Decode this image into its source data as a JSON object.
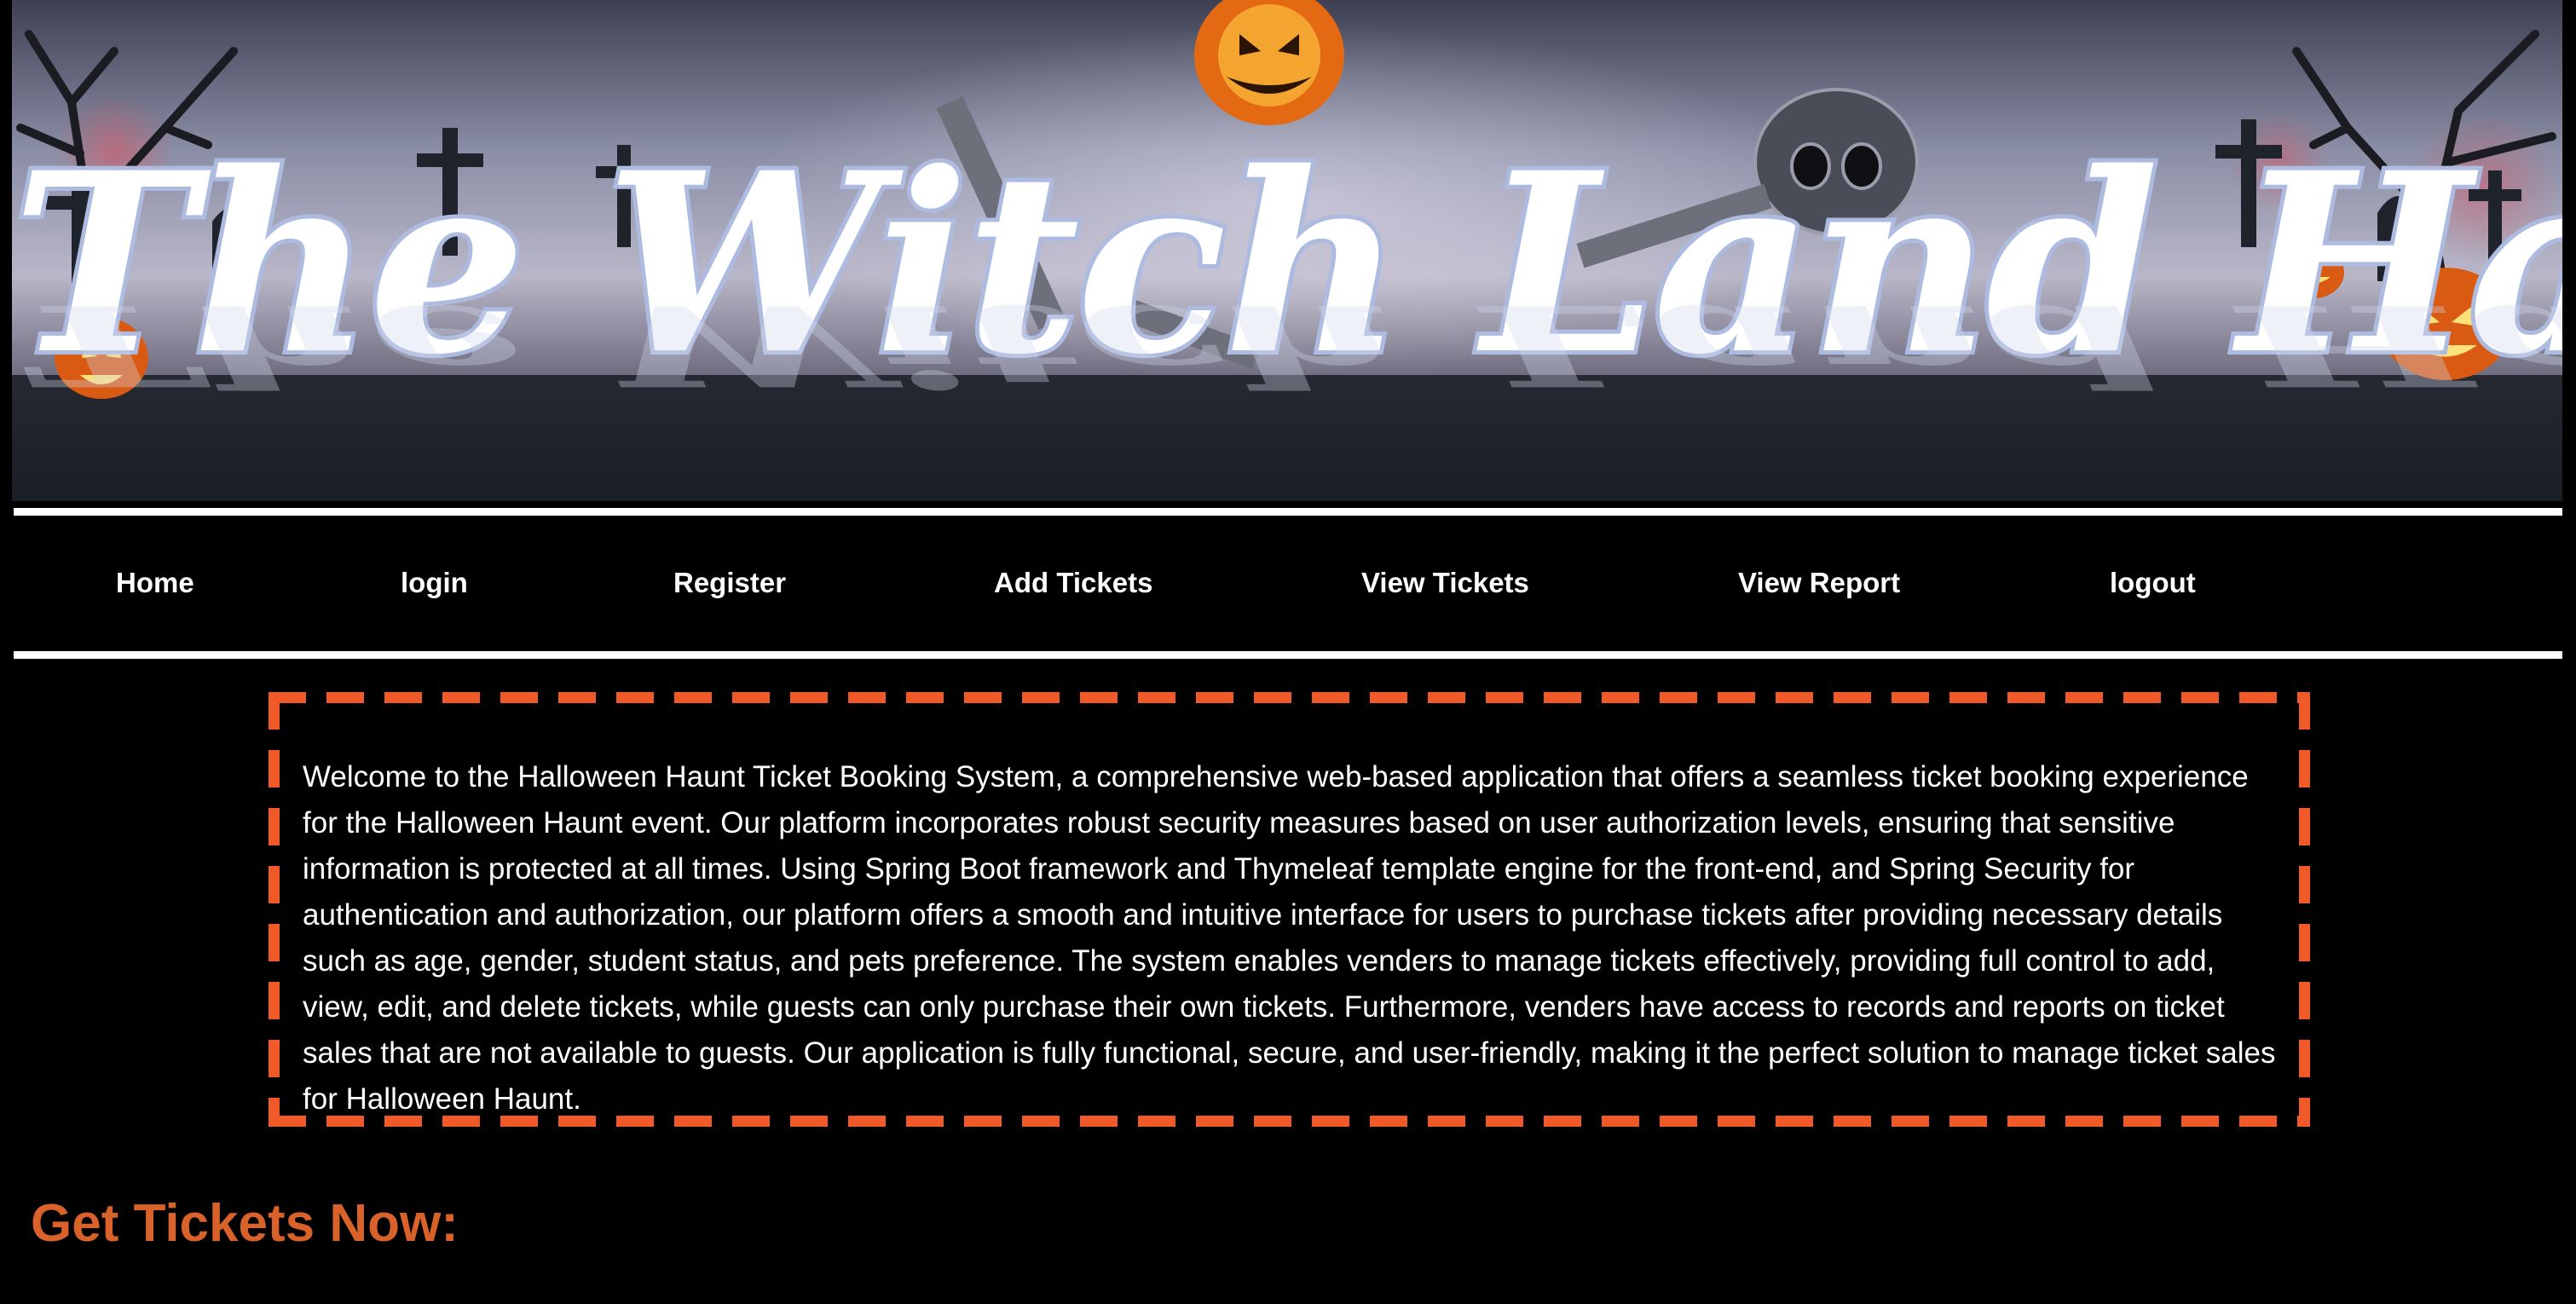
{
  "banner": {
    "title": "The Witch Land Haunt"
  },
  "nav": {
    "items": [
      {
        "label": "Home"
      },
      {
        "label": "login"
      },
      {
        "label": "Register"
      },
      {
        "label": "Add Tickets"
      },
      {
        "label": "View Tickets"
      },
      {
        "label": "View Report"
      },
      {
        "label": "logout"
      }
    ]
  },
  "intro": {
    "text": "Welcome to the Halloween Haunt Ticket Booking System, a comprehensive web-based application that offers a seamless ticket booking experience for the Halloween Haunt event. Our platform incorporates robust security measures based on user authorization levels, ensuring that sensitive information is protected at all times. Using Spring Boot framework and Thymeleaf template engine for the front-end, and Spring Security for authentication and authorization, our platform offers a smooth and intuitive interface for users to purchase tickets after providing necessary details such as age, gender, student status, and pets preference. The system enables venders to manage tickets effectively, providing full control to add, view, edit, and delete tickets, while guests can only purchase their own tickets. Furthermore, venders have access to records and reports on ticket sales that are not available to guests. Our application is fully functional, secure, and user-friendly, making it the perfect solution to manage ticket sales for Halloween Haunt."
  },
  "section": {
    "heading": "Get Tickets Now:"
  },
  "colors": {
    "background": "#000000",
    "accent_border": "#ef5a28",
    "heading": "#d9622b",
    "text": "#ffffff"
  }
}
